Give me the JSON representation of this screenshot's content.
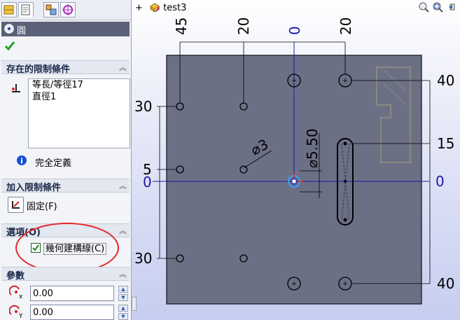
{
  "panel": {
    "tabs": [
      {
        "name": "feature-manager-tab-icon"
      },
      {
        "name": "property-manager-tab-icon"
      },
      {
        "name": "configuration-manager-tab-icon"
      },
      {
        "name": "dimxpert-tab-icon"
      }
    ],
    "title": "圓",
    "ok_icon": "checkmark-icon",
    "existing_relations": {
      "header": "存在的限制條件",
      "items": [
        "等長/等徑17",
        "直徑1"
      ],
      "status": "完全定義"
    },
    "add_relations": {
      "header": "加入限制條件",
      "fix_label": "固定(F)"
    },
    "options": {
      "header": "選項(O)",
      "construction_label": "幾何建構線(C)",
      "construction_checked": true
    },
    "parameters": {
      "header": "參數",
      "x_value": "0.00",
      "y_value": "0.00"
    }
  },
  "canvas": {
    "tree_label": "test3",
    "dims": {
      "top_45": "45",
      "top_20_left": "20",
      "top_0": "0",
      "top_20_right": "20",
      "right_40_top": "40",
      "right_15": "15",
      "right_0": "0",
      "right_40_bottom": "40",
      "left_30_top": "30",
      "left_5": "5",
      "left_0": "0",
      "left_30_bottom": "30",
      "dia_3": "⌀3",
      "dia_550": "⌀5.50"
    },
    "colors": {
      "plate": "#6b7085",
      "origin_axis": "#1a1aa8",
      "dimension": "#000000",
      "highlight": "#e4262b"
    }
  }
}
